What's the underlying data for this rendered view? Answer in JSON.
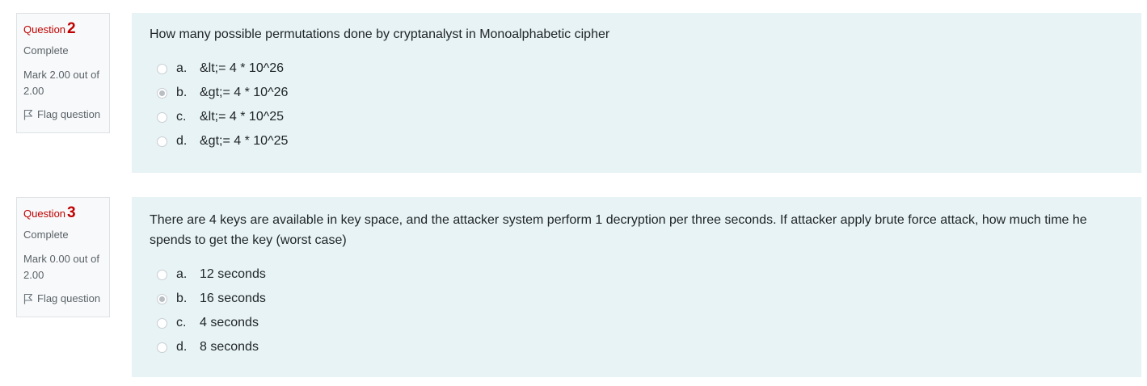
{
  "questions": [
    {
      "label": "Question",
      "number": "2",
      "state": "Complete",
      "grade": "Mark 2.00 out of 2.00",
      "flag_label": "Flag question",
      "text": "How many possible permutations done by cryptanalyst in Monoalphabetic cipher",
      "options": [
        {
          "letter": "a.",
          "text": "&lt;= 4 * 10^26",
          "checked": false
        },
        {
          "letter": "b.",
          "text": "&gt;= 4 * 10^26",
          "checked": true
        },
        {
          "letter": "c.",
          "text": "&lt;= 4 * 10^25",
          "checked": false
        },
        {
          "letter": "d.",
          "text": "&gt;= 4 * 10^25",
          "checked": false
        }
      ]
    },
    {
      "label": "Question",
      "number": "3",
      "state": "Complete",
      "grade": "Mark 0.00 out of 2.00",
      "flag_label": "Flag question",
      "text": "There are 4 keys are available in key space, and the attacker system perform 1 decryption per three seconds. If attacker apply brute force attack, how much time he spends to get the key (worst case)",
      "options": [
        {
          "letter": "a.",
          "text": "12 seconds",
          "checked": false
        },
        {
          "letter": "b.",
          "text": "16 seconds",
          "checked": true
        },
        {
          "letter": "c.",
          "text": "4 seconds",
          "checked": false
        },
        {
          "letter": "d.",
          "text": "8 seconds",
          "checked": false
        }
      ]
    }
  ],
  "colors": {
    "question_number": "#c00000",
    "content_bg": "#e7f3f5",
    "info_bg": "#f8f9fa"
  },
  "icons": {
    "flag": "flag-icon"
  }
}
